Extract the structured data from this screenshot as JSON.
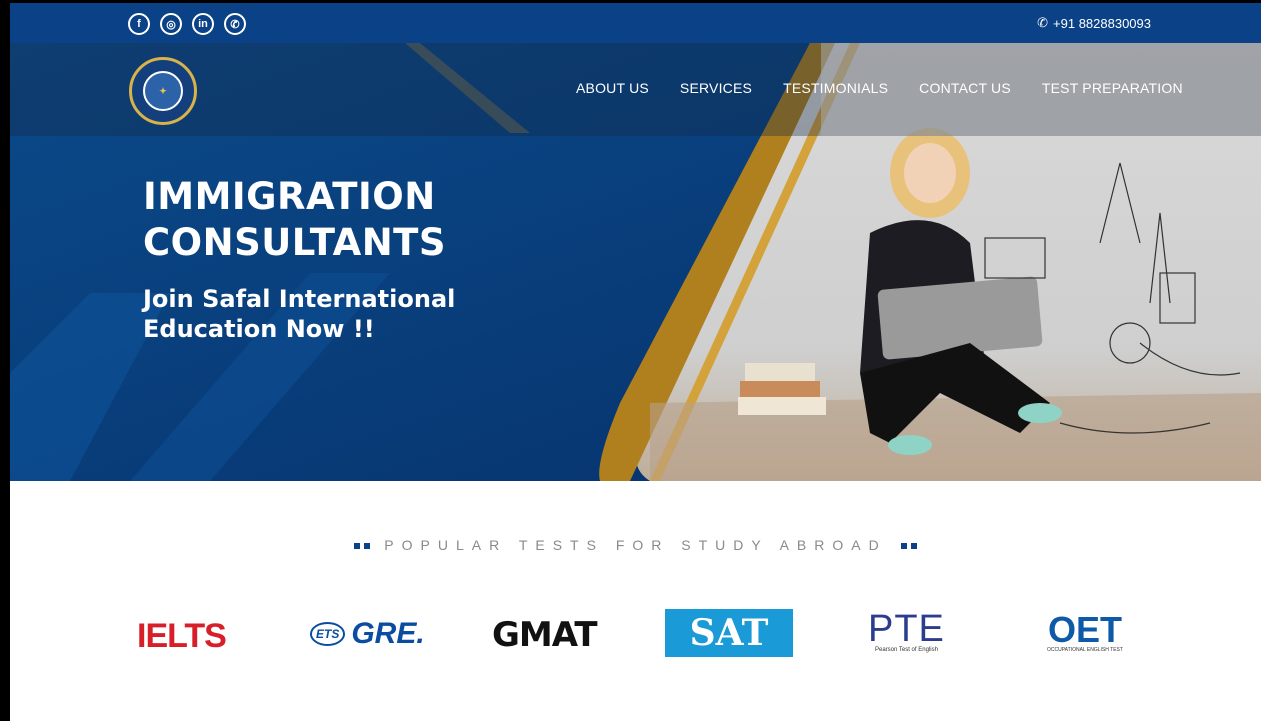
{
  "social": {
    "icons": [
      "facebook-icon",
      "instagram-icon",
      "linkedin-icon",
      "whatsapp-icon"
    ],
    "glyphs": [
      "f",
      "◎",
      "in",
      "✆"
    ]
  },
  "contact": {
    "phone": "+91 8828830093"
  },
  "logo": {
    "text": "Safal International Education"
  },
  "nav": {
    "items": [
      "ABOUT US",
      "SERVICES",
      "TESTIMONIALS",
      "CONTACT US",
      "TEST PREPARATION"
    ]
  },
  "hero": {
    "title_line1": "IMMIGRATION",
    "title_line2": "CONSULTANTS",
    "subtitle_line1": "Join Safal International",
    "subtitle_line2": "Education Now !!"
  },
  "tests": {
    "heading": "POPULAR TESTS FOR STUDY ABROAD",
    "ielts": "IELTS",
    "gre_prefix": "ETS",
    "gre": "GRE.",
    "gmat": "GMAT",
    "sat": "SAT",
    "pte": "PTE",
    "pte_sub": "Pearson Test of English",
    "oet": "OET",
    "oet_sub": "OCCUPATIONAL ENGLISH TEST"
  },
  "colors": {
    "topbar": "#0b4186",
    "hero": "#0a3f78",
    "gold": "#c8952a",
    "ielts": "#d71f2a",
    "sat": "#1a9ad7"
  }
}
